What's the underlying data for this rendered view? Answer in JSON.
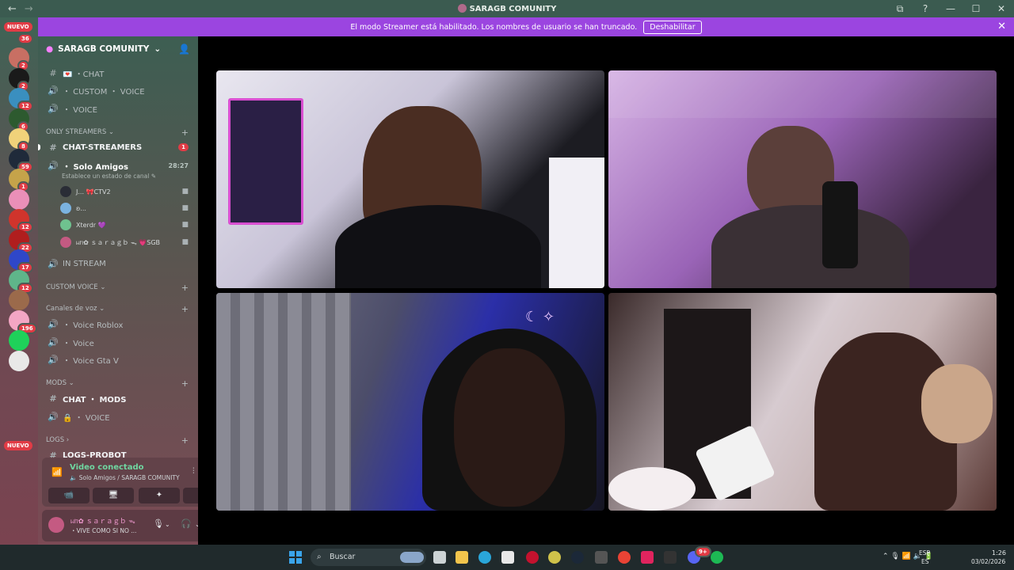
{
  "window": {
    "title": "SARAGB COMUNITY",
    "nav_back": "←",
    "nav_forward": "→",
    "controls": [
      "⧉",
      "?",
      "—",
      "☐",
      "✕"
    ]
  },
  "banner": {
    "text": "El modo Streamer está habilitado. Los nombres de usuario se han truncado.",
    "button": "Deshabilitar",
    "close": "✕"
  },
  "rail": {
    "top_badge": "NUEVO",
    "top_count": "36",
    "bottom_badge": "NUEVO",
    "servers": [
      {
        "badge": "2",
        "color": "#c86f63"
      },
      {
        "badge": "2",
        "color": "#1a1a1a"
      },
      {
        "badge": "12",
        "color": "#3a8fbf"
      },
      {
        "badge": "6",
        "color": "#2d5a2f"
      },
      {
        "badge": "8",
        "color": "#f0d27a"
      },
      {
        "badge": "59",
        "color": "#1f2a3a"
      },
      {
        "badge": "1",
        "color": "#c5a34a"
      },
      {
        "badge": "",
        "color": "#ea8fb8"
      },
      {
        "badge": "12",
        "color": "#d0342c"
      },
      {
        "badge": "22",
        "color": "#b01e1e"
      },
      {
        "badge": "17",
        "color": "#2f47c9"
      },
      {
        "badge": "12",
        "color": "#5fb58a"
      },
      {
        "badge": "",
        "color": "#9b6a4b"
      },
      {
        "badge": "196",
        "color": "#f3a6c4"
      },
      {
        "badge": "",
        "color": "#1fd15a"
      },
      {
        "badge": "",
        "color": "#e8e8e8"
      }
    ]
  },
  "sidebar": {
    "server_name": "SARAGB COMUNITY",
    "channels_top": [
      {
        "icon": "#",
        "name": "💌 ・CHAT"
      },
      {
        "icon": "🔊",
        "name": "・ CUSTOM ・ VOICE"
      },
      {
        "icon": "🔊",
        "name": "・ VOICE"
      }
    ],
    "cat_only_streamers": "ONLY STREAMERS",
    "chat_streamers": {
      "name": "CHAT-STREAMERS",
      "count": "1"
    },
    "solo_amigos": {
      "name": "・ Solo Amigos",
      "time": "28:27",
      "status": "Establece un estado de canal ✎"
    },
    "voice_users": [
      {
        "name": "J... 🎀CTV2",
        "color": "#e0e4e8"
      },
      {
        "name": "ʚ...",
        "color": "#7bb3e0"
      },
      {
        "name": "Xterdr 💜",
        "color": "#6fc28f"
      },
      {
        "name": "ᥕᥒ✿ ｓａｒａｇｂ ᯓ  💗SGB",
        "color": "#c45a82"
      }
    ],
    "in_stream": "IN STREAM",
    "cat_custom_voice": "CUSTOM VOICE",
    "cat_canales_voz": "Canales de voz",
    "voice_channels": [
      "・ Voice Roblox",
      "・ Voice",
      "・ Voice Gta V"
    ],
    "cat_mods": "MODS",
    "chat_mods": "CHAT ・ MODS",
    "mods_voice": "🔒 ・ VOICE",
    "cat_logs": "LOGS",
    "logs_probot": "LOGS-PROBOT"
  },
  "voice_panel": {
    "title": "Video conectado",
    "subtitle": "Solo Amigos / SARAGB COMUNITY",
    "buttons": [
      "📹",
      "🖥",
      "✦",
      "✨"
    ]
  },
  "user": {
    "name": "ᥕᥒ✿ ｓａｒａｇｂ ᯓ",
    "status": "・VIVE COMO SI NO ..."
  },
  "taskbar": {
    "search": "Buscar",
    "lang_top": "ESP",
    "lang_bottom": "ES",
    "time": "1:26",
    "date": "03/02/2026",
    "discord_badge": "9+",
    "tray_icons": "⌃   🎙   📶 🔈 🔋"
  }
}
